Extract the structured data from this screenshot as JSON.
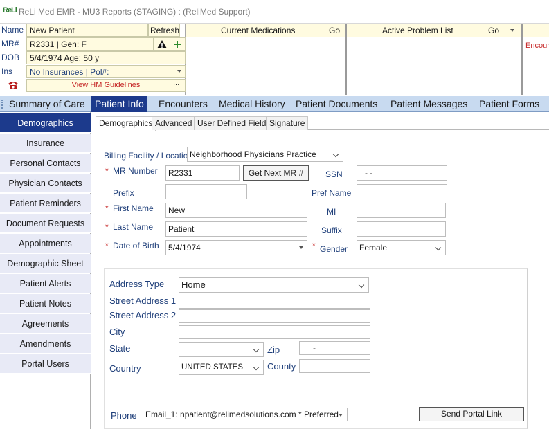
{
  "app": {
    "logo_text": "ReLi",
    "title": "ReLi Med EMR - MU3 Reports (STAGING) : (ReliMed Support)"
  },
  "patient_header": {
    "name_label": "Name",
    "name_value": "New Patient",
    "refresh_label": "Refresh",
    "mr_label": "MR#",
    "mr_value": "R2331 | Gen: F",
    "dob_label": "DOB",
    "dob_value": "5/4/1974  Age: 50 y",
    "ins_label": "Ins",
    "ins_value": "No Insurances | Pol#:",
    "hm_label": "View HM Guidelines",
    "hm_more": "..."
  },
  "panels": {
    "medications_title": "Current Medications",
    "medications_go": "Go",
    "problems_title": "Active Problem List",
    "problems_go": "Go",
    "encounter_partial": "Encoun"
  },
  "tabs": [
    {
      "label": "Summary of Care"
    },
    {
      "label": "Patient Info"
    },
    {
      "label": "Encounters"
    },
    {
      "label": "Medical History"
    },
    {
      "label": "Patient Documents"
    },
    {
      "label": "Patient Messages"
    },
    {
      "label": "Patient Forms"
    }
  ],
  "leftnav": [
    {
      "label": "Demographics"
    },
    {
      "label": "Insurance"
    },
    {
      "label": "Personal Contacts"
    },
    {
      "label": "Physician Contacts"
    },
    {
      "label": "Patient Reminders"
    },
    {
      "label": "Document Requests"
    },
    {
      "label": "Appointments"
    },
    {
      "label": "Demographic Sheet"
    },
    {
      "label": "Patient Alerts"
    },
    {
      "label": "Patient Notes"
    },
    {
      "label": "Agreements"
    },
    {
      "label": "Amendments"
    },
    {
      "label": "Portal Users"
    }
  ],
  "subtabs": [
    {
      "label": "Demographics"
    },
    {
      "label": "Advanced"
    },
    {
      "label": "User Defined Fields"
    },
    {
      "label": "Signature"
    }
  ],
  "form": {
    "billing_label": "Billing Facility / Location",
    "billing_value": "Neighborhood Physicians Practice",
    "mr_label": "MR Number",
    "mr_value": "R2331",
    "next_mr_button": "Get Next MR #",
    "ssn_label": "SSN",
    "ssn_value": "-  -",
    "prefix_label": "Prefix",
    "prefix_value": "",
    "pref_name_label": "Pref Name",
    "pref_name_value": "",
    "first_name_label": "First Name",
    "first_name_value": "New",
    "mi_label": "MI",
    "mi_value": "",
    "last_name_label": "Last Name",
    "last_name_value": "Patient",
    "suffix_label": "Suffix",
    "suffix_value": "",
    "dob_label": "Date of Birth",
    "dob_value": "5/4/1974",
    "gender_label": "Gender",
    "gender_value": "Female",
    "required_mark": "*"
  },
  "address": {
    "type_label": "Address Type",
    "type_value": "Home",
    "street1_label": "Street Address 1",
    "street1_value": "",
    "street2_label": "Street Address 2",
    "street2_value": "",
    "city_label": "City",
    "city_value": "",
    "state_label": "State",
    "state_value": "",
    "zip_label": "Zip",
    "zip_value": "-",
    "country_label": "Country",
    "country_value": "UNITED STATES",
    "county_label": "County",
    "county_value": "",
    "phone_label": "Phone",
    "phone_value": "Email_1: npatient@relimedsolutions.com * Preferred",
    "portal_button": "Send Portal Link"
  },
  "colors": {
    "accent": "#1c3a8c",
    "tabstrip": "#c8daf0",
    "nav_bg": "#e8eaf6",
    "header_yellow": "#fffbe0",
    "required": "#c62828"
  }
}
